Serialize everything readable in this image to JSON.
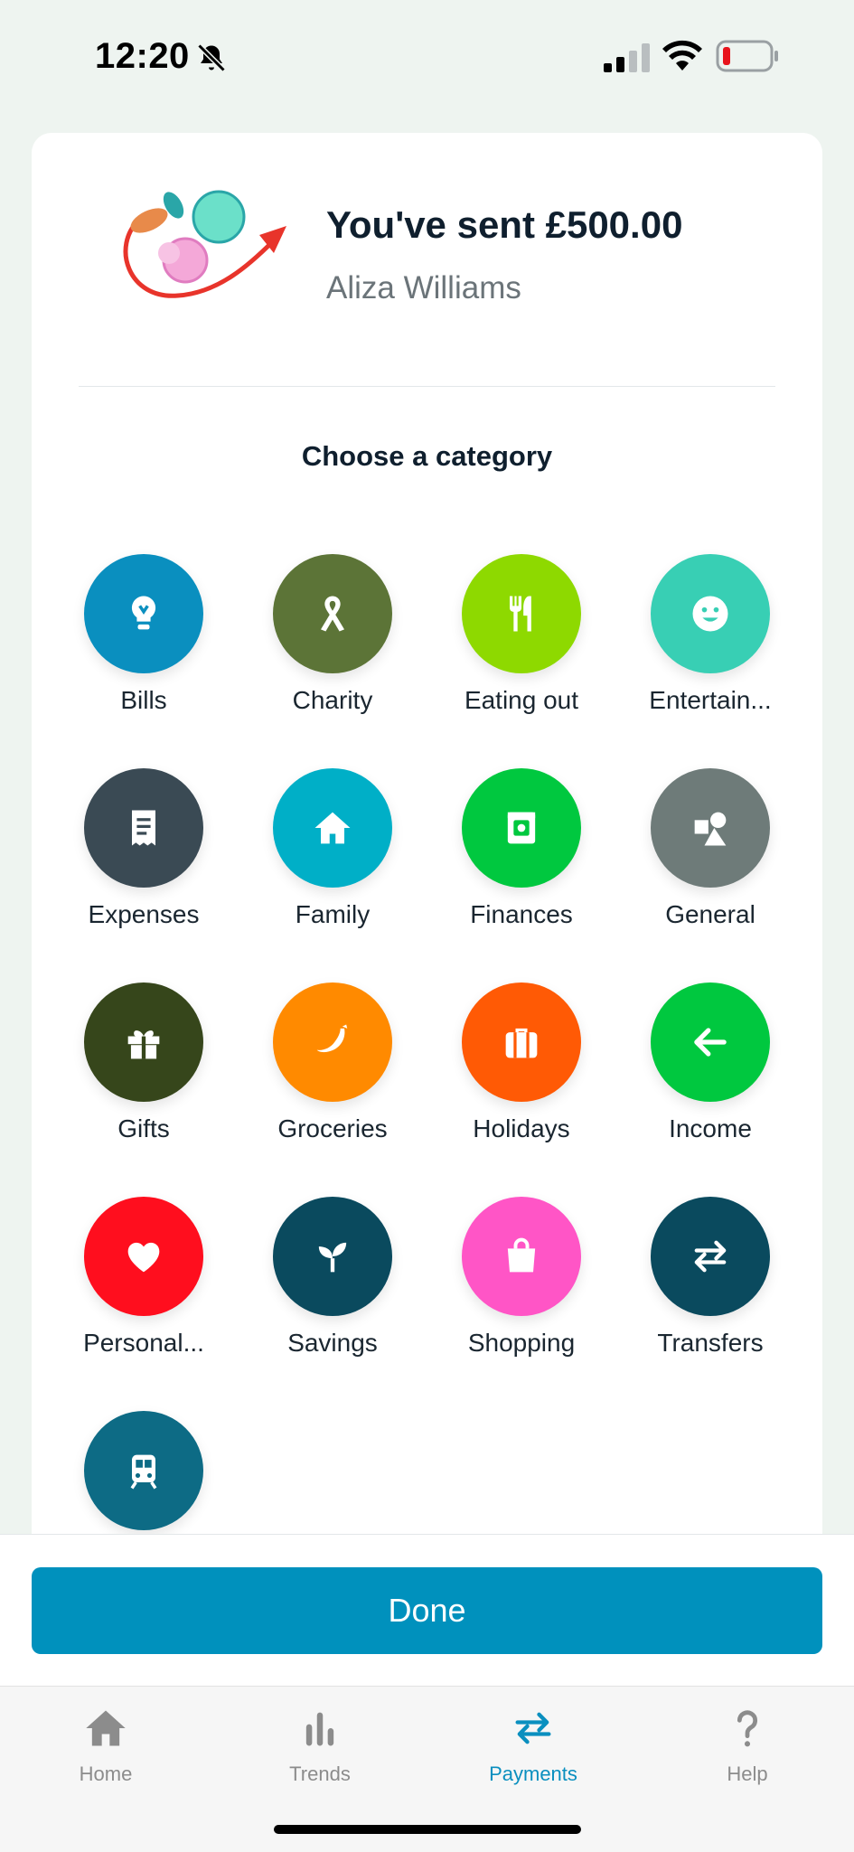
{
  "status_bar": {
    "time": "12:20"
  },
  "header": {
    "sent_title": "You've sent £500.00",
    "recipient": "Aliza Williams"
  },
  "section_title": "Choose a category",
  "categories": [
    {
      "label": "Bills",
      "color": "#0a8fbf",
      "icon": "lightbulb-icon"
    },
    {
      "label": "Charity",
      "color": "#5c7437",
      "icon": "ribbon-icon"
    },
    {
      "label": "Eating out",
      "color": "#8ed900",
      "icon": "cutlery-icon"
    },
    {
      "label": "Entertain...",
      "color": "#38cfb4",
      "icon": "smiley-icon"
    },
    {
      "label": "Expenses",
      "color": "#3a4a54",
      "icon": "receipt-icon"
    },
    {
      "label": "Family",
      "color": "#00afc7",
      "icon": "house-icon"
    },
    {
      "label": "Finances",
      "color": "#00c83f",
      "icon": "cash-icon"
    },
    {
      "label": "General",
      "color": "#6e7b79",
      "icon": "shapes-icon"
    },
    {
      "label": "Gifts",
      "color": "#36461b",
      "icon": "gift-icon"
    },
    {
      "label": "Groceries",
      "color": "#ff8a00",
      "icon": "banana-icon"
    },
    {
      "label": "Holidays",
      "color": "#ff5a05",
      "icon": "suitcase-icon"
    },
    {
      "label": "Income",
      "color": "#00c83f",
      "icon": "arrow-left-icon"
    },
    {
      "label": "Personal...",
      "color": "#ff0e1e",
      "icon": "heart-icon"
    },
    {
      "label": "Savings",
      "color": "#0a4a5e",
      "icon": "sprout-icon"
    },
    {
      "label": "Shopping",
      "color": "#ff55c6",
      "icon": "shopping-bag-icon"
    },
    {
      "label": "Transfers",
      "color": "#0a4a5e",
      "icon": "transfer-arrows-icon"
    },
    {
      "label": "",
      "color": "#0d6b85",
      "icon": "train-icon"
    }
  ],
  "done_label": "Done",
  "tabs": [
    {
      "label": "Home",
      "icon": "home-icon",
      "active": false
    },
    {
      "label": "Trends",
      "icon": "bar-chart-icon",
      "active": false
    },
    {
      "label": "Payments",
      "icon": "transfer-arrows-icon",
      "active": true
    },
    {
      "label": "Help",
      "icon": "question-icon",
      "active": false
    }
  ],
  "colors": {
    "accent": "#0091bd",
    "active_tab": "#0a8fbf",
    "inactive_tab": "#8c8c8c",
    "background": "#eef4f0"
  }
}
